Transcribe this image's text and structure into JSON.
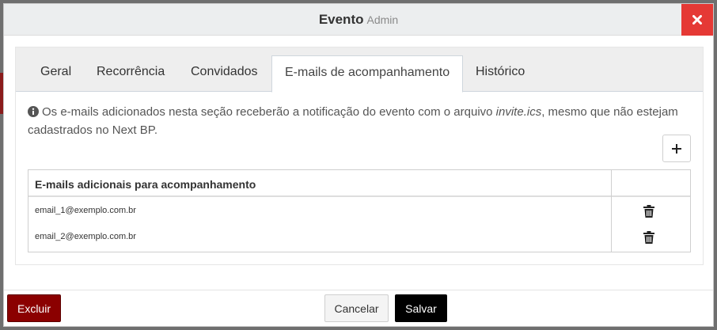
{
  "modal": {
    "title": "Evento",
    "subtitle": "Admin",
    "close_icon": "close-icon",
    "close_color": "#e53935"
  },
  "tabs": [
    {
      "label": "Geral",
      "active": false
    },
    {
      "label": "Recorrência",
      "active": false
    },
    {
      "label": "Convidados",
      "active": false
    },
    {
      "label": "E-mails de acompanhamento",
      "active": true
    },
    {
      "label": "Histórico",
      "active": false
    }
  ],
  "info": {
    "icon": "info-circle-icon",
    "text_before": "Os e-mails adicionados nesta seção receberão a notificação do evento com o arquivo ",
    "filename": "invite.ics",
    "text_after": ", mesmo que não estejam cadastrados no Next BP."
  },
  "add_button": {
    "icon": "plus-icon"
  },
  "table": {
    "header": "E-mails adicionais para acompanhamento",
    "rows": [
      {
        "email": "email_1@exemplo.com.br",
        "action_icon": "trash-icon"
      },
      {
        "email": "email_2@exemplo.com.br",
        "action_icon": "trash-icon"
      }
    ]
  },
  "footer": {
    "delete_label": "Excluir",
    "cancel_label": "Cancelar",
    "save_label": "Salvar",
    "delete_color": "#8b0000",
    "save_color": "#000000"
  }
}
